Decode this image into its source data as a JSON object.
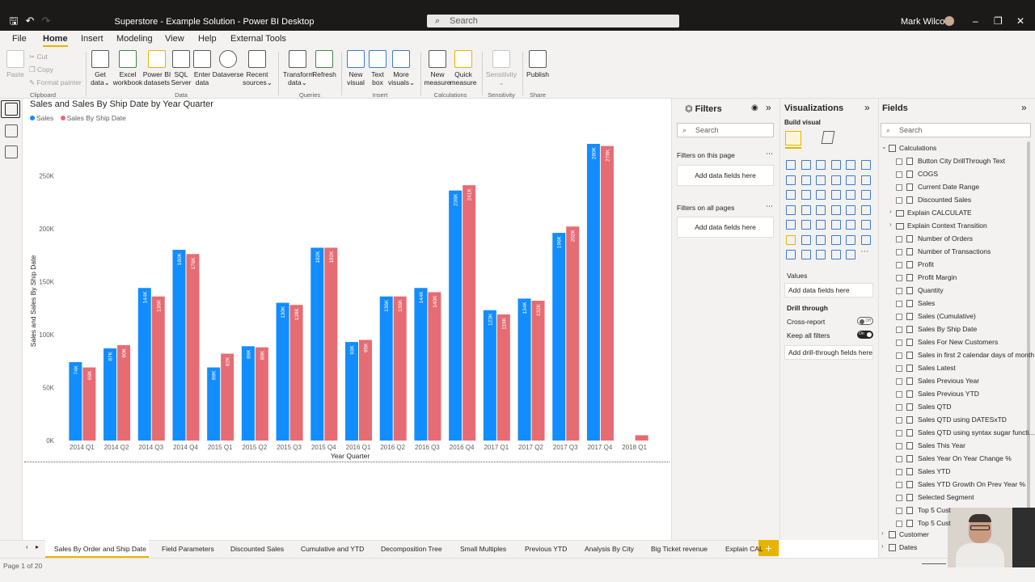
{
  "window": {
    "title": "Superstore - Example Solution - Power BI Desktop",
    "search_placeholder": "Search",
    "user_name": "Mark Wilcock"
  },
  "menu": [
    "File",
    "Home",
    "Insert",
    "Modeling",
    "View",
    "Help",
    "External Tools"
  ],
  "ribbon": {
    "clipboard": {
      "paste": "Paste",
      "cut": "Cut",
      "copy": "Copy",
      "format_painter": "Format painter",
      "group": "Clipboard"
    },
    "data": {
      "get_data": [
        "Get",
        "data"
      ],
      "excel": [
        "Excel",
        "workbook"
      ],
      "powerbi": [
        "Power BI",
        "datasets"
      ],
      "sql": [
        "SQL",
        "Server"
      ],
      "enter": [
        "Enter",
        "data"
      ],
      "dataverse": [
        "Dataverse",
        ""
      ],
      "recent": [
        "Recent",
        "sources"
      ],
      "group": "Data"
    },
    "queries": {
      "transform": [
        "Transform",
        "data"
      ],
      "refresh": [
        "Refresh",
        ""
      ],
      "group": "Queries"
    },
    "insert": {
      "new_visual": [
        "New",
        "visual"
      ],
      "text_box": [
        "Text",
        "box"
      ],
      "more": [
        "More",
        "visuals"
      ],
      "group": "Insert"
    },
    "calculations": {
      "new_measure": [
        "New",
        "measure"
      ],
      "quick_measure": [
        "Quick",
        "measure"
      ],
      "group": "Calculations"
    },
    "sensitivity": {
      "label": [
        "Sensitivity",
        ""
      ],
      "group": "Sensitivity"
    },
    "share": {
      "publish": [
        "Publish",
        ""
      ],
      "group": "Share"
    }
  },
  "chart_data": {
    "type": "bar",
    "title": "Sales and Sales By Ship Date by Year Quarter",
    "xlabel": "Year Quarter",
    "ylabel": "Sales and Sales By Ship Date",
    "ylim": [
      0,
      280000
    ],
    "yticks": [
      "0K",
      "50K",
      "100K",
      "150K",
      "200K",
      "250K"
    ],
    "ytick_values": [
      0,
      50000,
      100000,
      150000,
      200000,
      250000
    ],
    "categories": [
      "2014 Q1",
      "2014 Q2",
      "2014 Q3",
      "2014 Q4",
      "2015 Q1",
      "2015 Q2",
      "2015 Q3",
      "2015 Q4",
      "2016 Q1",
      "2016 Q2",
      "2016 Q3",
      "2016 Q4",
      "2017 Q1",
      "2017 Q2",
      "2017 Q3",
      "2017 Q4",
      "2018 Q1"
    ],
    "series": [
      {
        "name": "Sales",
        "color": "#118dff",
        "values": [
          74000,
          87000,
          144000,
          180000,
          69000,
          89000,
          130000,
          182000,
          93000,
          136000,
          144000,
          236000,
          123000,
          134000,
          196000,
          280000,
          0
        ],
        "labels": [
          "74K",
          "87K",
          "144K",
          "180K",
          "69K",
          "89K",
          "130K",
          "182K",
          "93K",
          "136K",
          "144K",
          "236K",
          "123K",
          "134K",
          "196K",
          "280K",
          ""
        ]
      },
      {
        "name": "Sales By Ship Date",
        "color": "#e66c74",
        "values": [
          69000,
          90000,
          136000,
          176000,
          82000,
          88000,
          128000,
          182000,
          95000,
          136000,
          140000,
          241000,
          119000,
          132000,
          202000,
          278000,
          5000
        ],
        "labels": [
          "69K",
          "90K",
          "136K",
          "176K",
          "82K",
          "88K",
          "128K",
          "182K",
          "95K",
          "136K",
          "140K",
          "241K",
          "119K",
          "132K",
          "202K",
          "278K",
          ""
        ]
      }
    ],
    "legend_position": "top-left",
    "grid": false
  },
  "filters": {
    "title": "Filters",
    "search": "Search",
    "on_page": "Filters on this page",
    "on_all": "Filters on all pages",
    "add": "Add data fields here"
  },
  "visualizations": {
    "title": "Visualizations",
    "build": "Build visual",
    "values": "Values",
    "values_add": "Add data fields here",
    "drill": "Drill through",
    "cross_report": "Cross-report",
    "cross_state": "Off",
    "keep_filters": "Keep all filters",
    "keep_state": "On",
    "drill_add": "Add drill-through fields here"
  },
  "fields": {
    "title": "Fields",
    "search": "Search",
    "tables": [
      {
        "name": "Calculations",
        "expanded": true
      },
      {
        "name": "Customer",
        "expanded": false
      },
      {
        "name": "Dates",
        "expanded": false
      }
    ],
    "items": [
      "Button City DrillThrough Text",
      "COGS",
      "Current Date Range",
      "Discounted Sales",
      "Explain CALCULATE",
      "Explain Context Transition",
      "Number of Orders",
      "Number of Transactions",
      "Profit",
      "Profit Margin",
      "Quantity",
      "Sales",
      "Sales (Cumulative)",
      "Sales By Ship Date",
      "Sales For New Customers",
      "Sales in first 2 calendar days of month",
      "Sales Latest",
      "Sales Previous Year",
      "Sales Previous YTD",
      "Sales QTD",
      "Sales QTD using DATESxTD",
      "Sales QTD using syntax sugar functi...",
      "Sales This Year",
      "Sales Year On Year Change %",
      "Sales YTD",
      "Sales YTD Growth On Prev Year %",
      "Selected Segment",
      "Top 5 Cust",
      "Top 5 Cust"
    ]
  },
  "tabs": [
    "Sales By Order and Ship Date",
    "Field Parameters",
    "Discounted Sales",
    "Cumulative and YTD",
    "Decomposition Tree",
    "Small Multiples",
    "Previous YTD",
    "Analysis By City",
    "Big Ticket revenue",
    "Explain CAL"
  ],
  "status": {
    "page": "Page 1 of 20"
  }
}
